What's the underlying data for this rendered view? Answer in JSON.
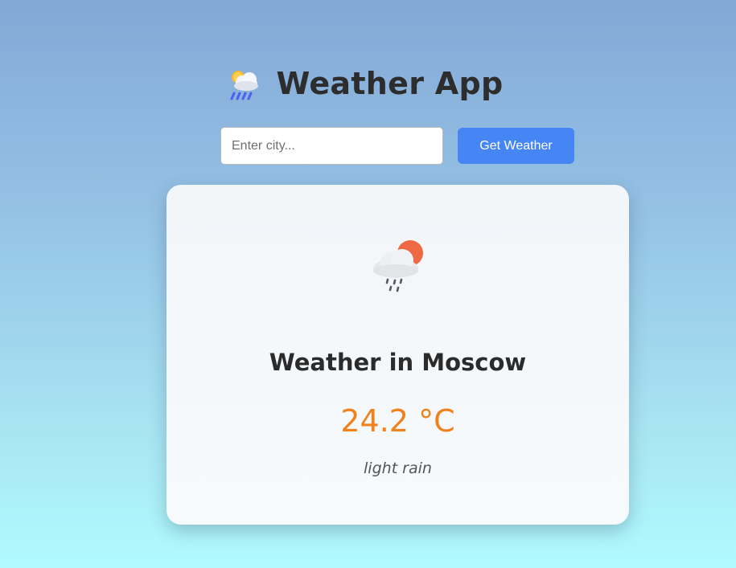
{
  "app": {
    "title": "Weather App",
    "header_icon": "sun-cloud-rain-icon"
  },
  "search": {
    "placeholder": "Enter city...",
    "value": "",
    "button_label": "Get Weather"
  },
  "weather": {
    "icon": "cloud-sun-rain-icon",
    "heading": "Weather in Moscow",
    "temperature": "24.2 °C",
    "description": "light rain"
  },
  "colors": {
    "accent": "#4586f4",
    "temperature": "#f0821e",
    "title": "#2d2d2d"
  }
}
